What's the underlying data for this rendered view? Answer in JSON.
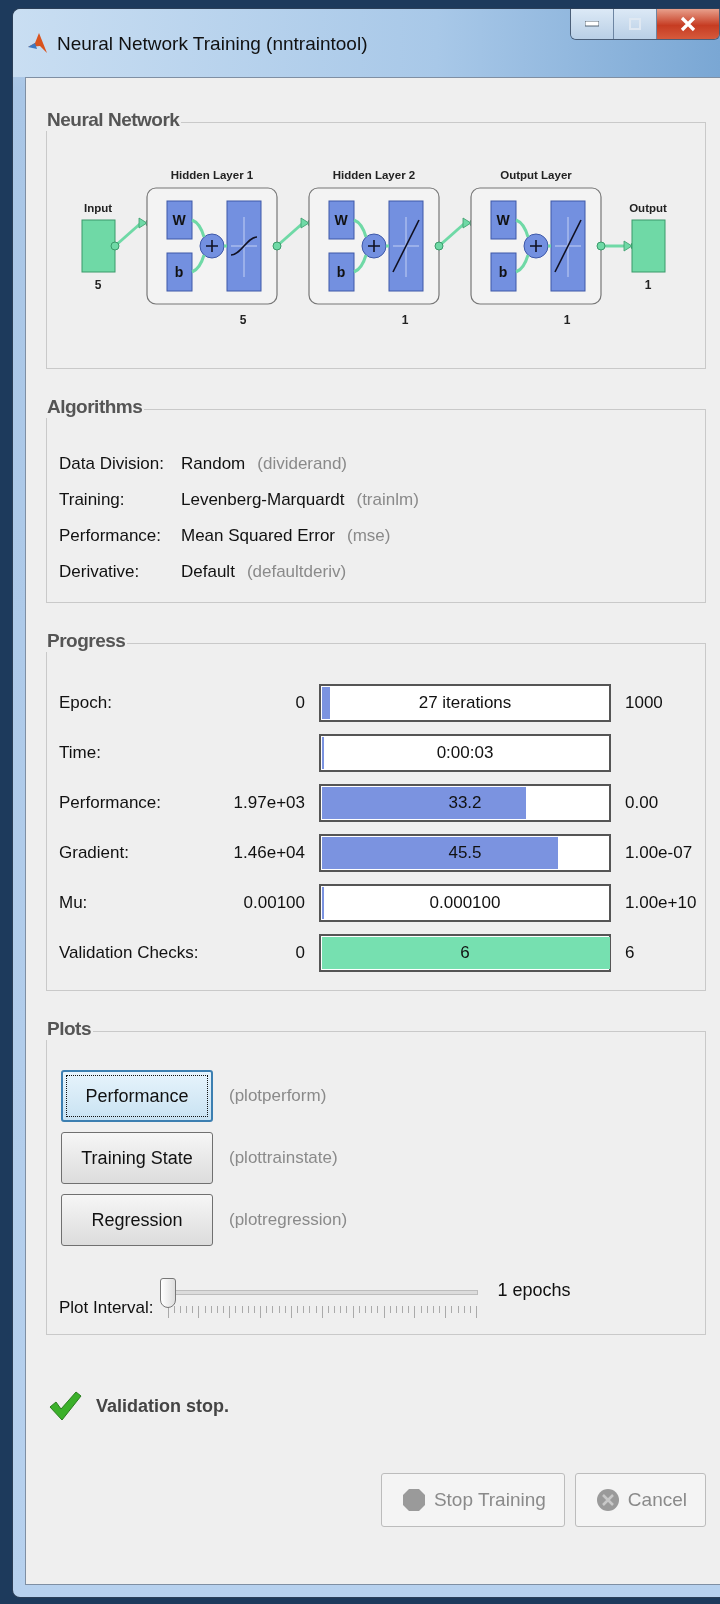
{
  "window": {
    "title": "Neural Network Training (nntraintool)"
  },
  "network": {
    "title": "Neural Network",
    "input": {
      "label": "Input",
      "size": "5"
    },
    "layers": [
      {
        "title": "Hidden Layer 1",
        "weight_label": "W",
        "bias_label": "b",
        "kind": "tansig",
        "size": "5"
      },
      {
        "title": "Hidden Layer 2",
        "weight_label": "W",
        "bias_label": "b",
        "kind": "purelin",
        "size": "1"
      },
      {
        "title": "Output Layer",
        "weight_label": "W",
        "bias_label": "b",
        "kind": "purelin",
        "size": "1"
      }
    ],
    "output": {
      "label": "Output",
      "size": "1"
    }
  },
  "algorithms": {
    "title": "Algorithms",
    "rows": [
      {
        "label": "Data Division:",
        "value": "Random",
        "function": "(dividerand)"
      },
      {
        "label": "Training:",
        "value": "Levenberg-Marquardt",
        "function": "(trainlm)"
      },
      {
        "label": "Performance:",
        "value": "Mean Squared Error",
        "function": "(mse)"
      },
      {
        "label": "Derivative:",
        "value": "Default",
        "function": "(defaultderiv)"
      }
    ]
  },
  "progress": {
    "title": "Progress",
    "rows": [
      {
        "label": "Epoch:",
        "start": "0",
        "value": "27 iterations",
        "end": "1000",
        "level": 0.027,
        "color": "#7b93e0"
      },
      {
        "label": "Time:",
        "value": "0:00:03",
        "level": 0,
        "color": "#7b93e0"
      },
      {
        "label": "Performance:",
        "start": "1.97e+03",
        "value": "33.2",
        "end": "0.00",
        "level": 0.71,
        "color": "#7b93e0"
      },
      {
        "label": "Gradient:",
        "start": "1.46e+04",
        "value": "45.5",
        "end": "1.00e-07",
        "level": 0.82,
        "color": "#7b93e0"
      },
      {
        "label": "Mu:",
        "start": "0.00100",
        "value": "0.000100",
        "end": "1.00e+10",
        "level": 0,
        "color": "#7b93e0"
      },
      {
        "label": "Validation Checks:",
        "start": "0",
        "value": "6",
        "end": "6",
        "level": 1,
        "color": "#76e0b0"
      }
    ]
  },
  "plots": {
    "title": "Plots",
    "buttons": [
      {
        "label": "Performance",
        "function": "(plotperform)",
        "focused": true
      },
      {
        "label": "Training State",
        "function": "(plottrainstate)",
        "focused": false
      },
      {
        "label": "Regression",
        "function": "(plotregression)",
        "focused": false
      }
    ],
    "interval": {
      "label": "Plot Interval:",
      "level": 0,
      "reading": "1 epochs"
    }
  },
  "status": {
    "text": "Validation stop."
  },
  "buttons": [
    {
      "label": "Stop Training",
      "kind": "stop",
      "disabled": true
    },
    {
      "label": "Cancel",
      "kind": "cancel",
      "disabled": true
    }
  ]
}
